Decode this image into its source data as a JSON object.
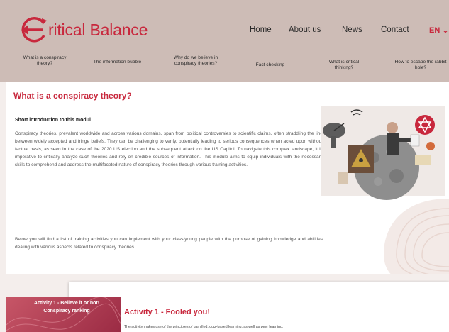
{
  "brand": {
    "logo_letter": "C",
    "logo_text": "ritical Balance",
    "accent": "#c8283d"
  },
  "nav": {
    "home": "Home",
    "about": "About us",
    "news": "News",
    "contact": "Contact",
    "lang": "EN ⌄"
  },
  "subnav": [
    "What is a conspiracy theory?",
    "The information bubble",
    "Why do we believe in conspiracy theories?",
    "Fact checking",
    "What is critical thinking?",
    "How to escape the rabbit hole?"
  ],
  "main": {
    "title": "What is a conspiracy theory?",
    "intro_title": "Short introduction to this modul",
    "intro_text": "Conspiracy theories, prevalent worldwide and across various domains, span from political controversies to scientific claims, often straddling the line between widely accepted and fringe beliefs. They can be challenging to verify, potentially leading to serious consequences when acted upon without factual basis, as seen in the case of the 2020 US election and the subsequent attack on the US Capitol. To navigate this complex landscape, it is imperative to critically analyze such theories and rely on credible sources of information. This module aims to equip individuals with the necessary skills to comprehend and address the multifaceted nature of conspiracy theories through various training activities.",
    "below_text": "Below you will find a list of training activities you can implement with your class/young people with the purpose of gaining knowledge and abilities dealing with various aspects related to conspiracy theories."
  },
  "activity": {
    "thumb_title": "Activity 1 - Believe it or not!",
    "thumb_subtitle": "Conspiracy ranking",
    "title": "Activity 1 - Fooled you!",
    "description": "The activity makes use of the principles of gamified, quiz-based learning, as well as peer learning."
  }
}
